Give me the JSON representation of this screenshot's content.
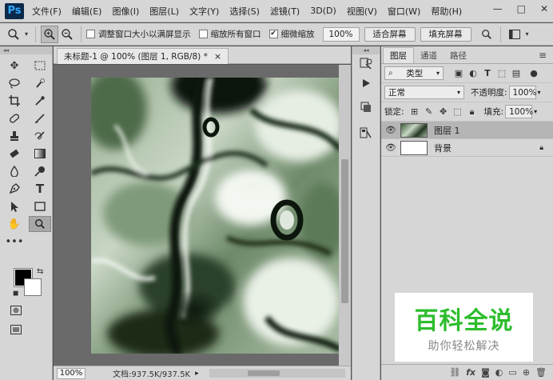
{
  "app": {
    "logo": "Ps"
  },
  "menubar": {
    "items": [
      "文件(F)",
      "编辑(E)",
      "图像(I)",
      "图层(L)",
      "文字(Y)",
      "选择(S)",
      "滤镜(T)",
      "3D(D)",
      "视图(V)",
      "窗口(W)",
      "帮助(H)"
    ],
    "window_controls": [
      "—",
      "□",
      "✕"
    ]
  },
  "options": {
    "resize_window": "调整窗口大小以满屏显示",
    "zoom_all_windows": "缩放所有窗口",
    "scrubby_zoom": "细微缩放",
    "zoom_value": "100%",
    "fit_screen": "适合屏幕",
    "fill_screen": "填充屏幕"
  },
  "document": {
    "tab_title": "未标题-1 @ 100% (图层 1, RGB/8) *",
    "close": "×"
  },
  "statusbar": {
    "zoom": "100%",
    "doc_size": "文档:937.5K/937.5K"
  },
  "layers_panel": {
    "tabs": [
      "图层",
      "通道",
      "路径"
    ],
    "kind_filter": "类型",
    "blend_mode": "正常",
    "opacity_label": "不透明度:",
    "opacity_value": "100%",
    "lock_label": "锁定:",
    "fill_label": "填充:",
    "fill_value": "100%",
    "layers": [
      {
        "name": "图层 1",
        "selected": true
      },
      {
        "name": "背景",
        "selected": false
      }
    ],
    "footer_icons": [
      "link-icon",
      "fx-icon",
      "mask-icon",
      "adjustment-icon",
      "group-icon",
      "new-layer-icon",
      "trash-icon"
    ]
  },
  "watermark": {
    "main": "百科全说",
    "sub": "助你轻松解决"
  },
  "colors": {
    "foreground": "#000000",
    "background": "#ffffff",
    "watermark_green": "#2dbd2d",
    "artwork_green": "#5c7a5a"
  }
}
